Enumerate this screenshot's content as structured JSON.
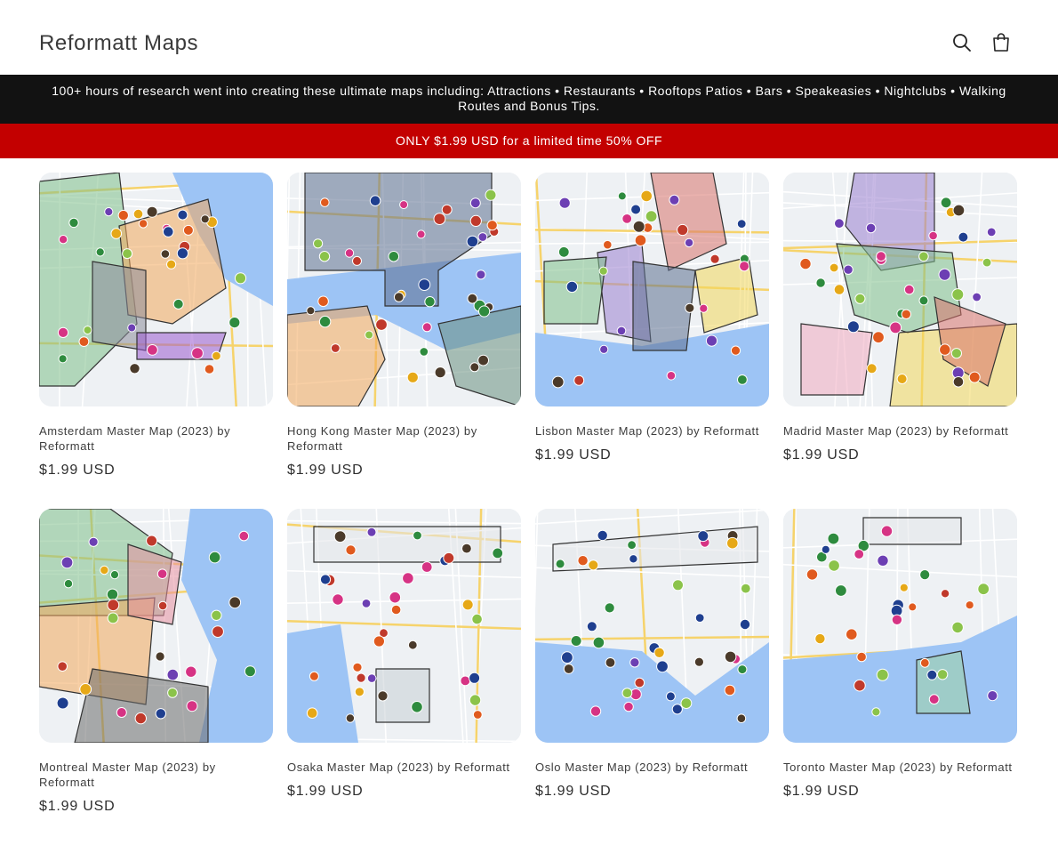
{
  "header": {
    "logo": "Reformatt Maps",
    "icons": [
      "search-icon",
      "cart-icon"
    ]
  },
  "announcement": {
    "text": "100+ hours of research went into creating these ultimate maps including: Attractions • Restaurants • Rooftops Patios • Bars • Speakeasies • Nightclubs • Walking Routes and Bonus Tips."
  },
  "promo": {
    "text": "ONLY $1.99 USD for a limited time 50% OFF"
  },
  "colors": {
    "announcement_bg": "#121212",
    "promo_bg": "#c30000",
    "water": "#9dc4f5",
    "land": "#eef1f4"
  },
  "products": [
    {
      "title": "Amsterdam Master Map (2023) by Reformatt",
      "price": "$1.99 USD"
    },
    {
      "title": "Hong Kong Master Map (2023) by Reformatt",
      "price": "$1.99 USD"
    },
    {
      "title": "Lisbon Master Map (2023) by Reformatt",
      "price": "$1.99 USD"
    },
    {
      "title": "Madrid Master Map (2023) by Reformatt",
      "price": "$1.99 USD"
    },
    {
      "title": "Montreal Master Map (2023) by Reformatt",
      "price": "$1.99 USD"
    },
    {
      "title": "Osaka Master Map (2023) by Reformatt",
      "price": "$1.99 USD"
    },
    {
      "title": "Oslo Master Map (2023) by Reformatt",
      "price": "$1.99 USD"
    },
    {
      "title": "Toronto Master Map (2023) by Reformatt",
      "price": "$1.99 USD"
    }
  ]
}
